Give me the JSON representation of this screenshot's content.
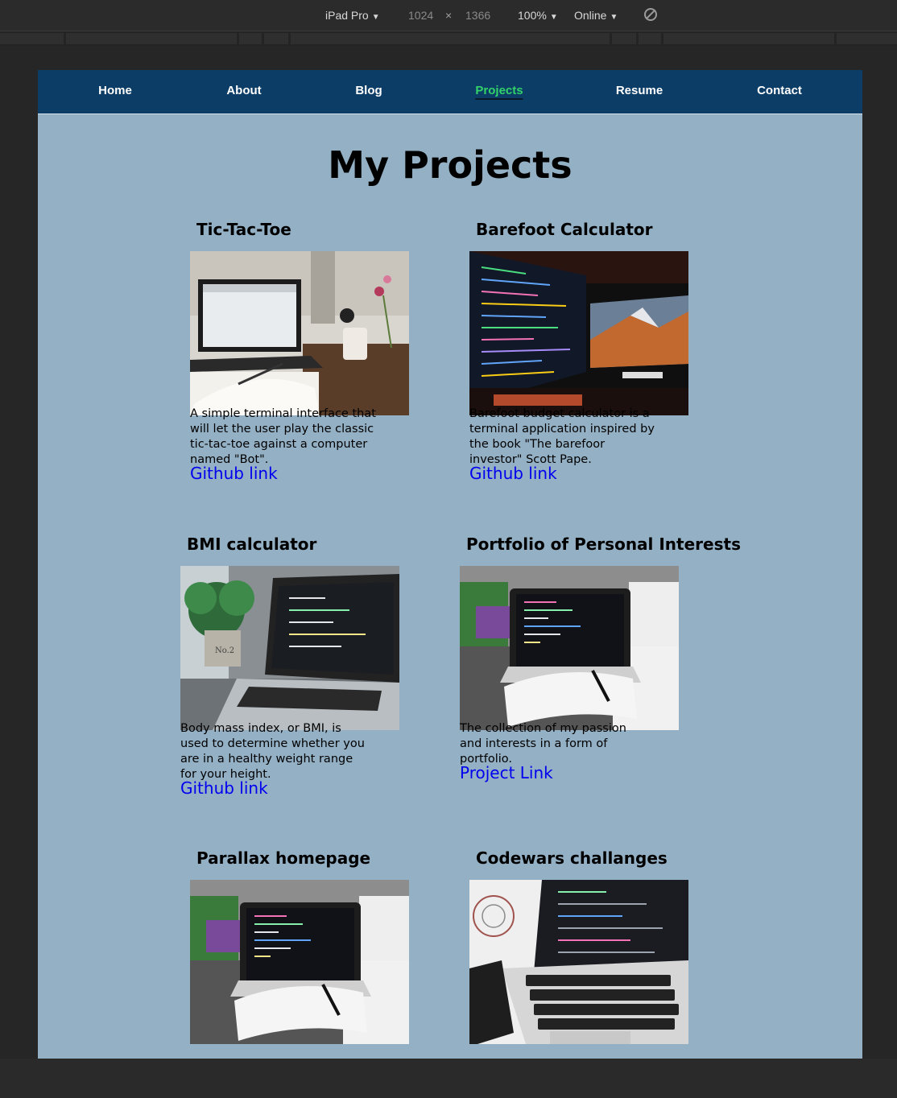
{
  "devtools": {
    "device": "iPad Pro",
    "width": "1024",
    "times": "×",
    "height": "1366",
    "zoom": "100%",
    "network": "Online"
  },
  "nav": {
    "items": [
      {
        "label": "Home",
        "active": false
      },
      {
        "label": "About",
        "active": false
      },
      {
        "label": "Blog",
        "active": false
      },
      {
        "label": "Projects",
        "active": true
      },
      {
        "label": "Resume",
        "active": false
      },
      {
        "label": "Contact",
        "active": false
      }
    ]
  },
  "page_title": "My Projects",
  "projects": [
    {
      "title": "Tic-Tac-Toe",
      "description": "A simple terminal interface that will let the user play the classic tic-tac-toe against a computer named \"Bot\".",
      "link": "Github link",
      "image": "laptop-desk-photo"
    },
    {
      "title": "Barefoot Calculator",
      "description": "Barefoot budget calculator is a terminal application inspired by the book \"The barefoor investor\" Scott Pape.",
      "link": "Github link",
      "image": "dual-monitor-code-photo"
    },
    {
      "title": "BMI calculator",
      "description": "Body mass index, or BMI, is used to determine whether you are in a healthy weight range for your height.",
      "link": "Github link",
      "image": "laptop-plant-photo"
    },
    {
      "title": "Portfolio of Personal Interests",
      "description": "The collection of my passion and interests in a form of portfolio.",
      "link": "Project Link",
      "image": "laptop-notebook-photo"
    },
    {
      "title": "Parallax homepage",
      "description": "",
      "link": "",
      "image": "laptop-notebook-photo"
    },
    {
      "title": "Codewars challanges",
      "description": "",
      "link": "",
      "image": "laptop-keyboard-photo"
    }
  ],
  "colors": {
    "nav_bg": "#0b3d66",
    "page_bg": "#94b0c5",
    "active_nav": "#33d36a",
    "link": "#0000ee"
  }
}
